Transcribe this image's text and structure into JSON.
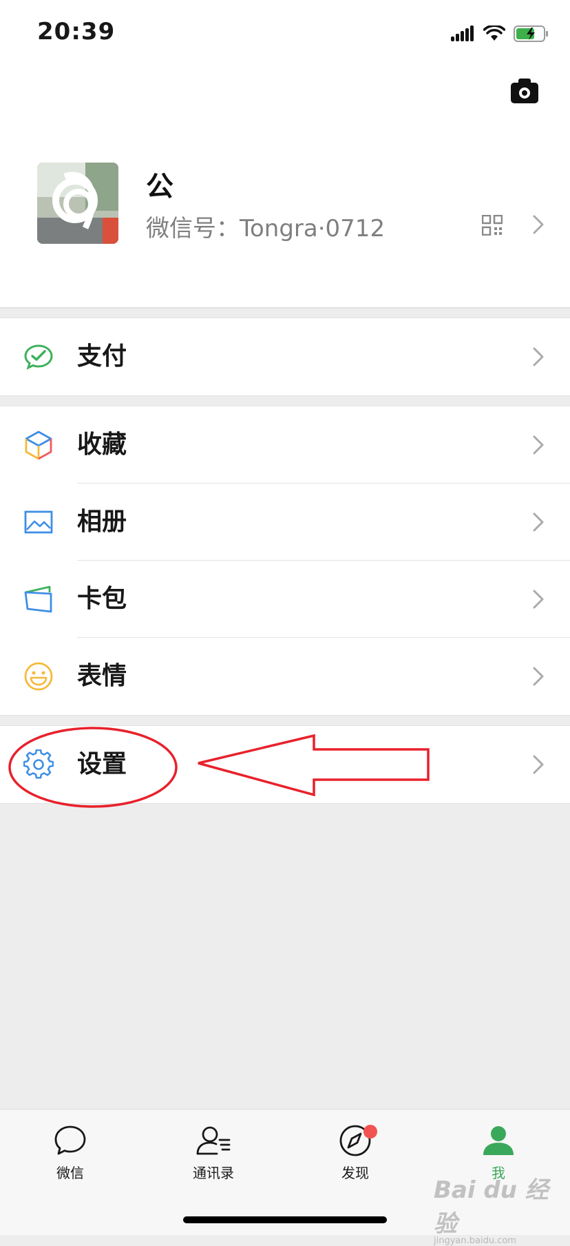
{
  "status_bar": {
    "time": "20:39"
  },
  "profile": {
    "nickname": "公",
    "wechat_id": "微信号：Tongra·0712"
  },
  "menu_groups": [
    {
      "items": [
        {
          "label": "支付",
          "icon": "pay-icon"
        }
      ]
    },
    {
      "items": [
        {
          "label": "收藏",
          "icon": "favorites-icon"
        },
        {
          "label": "相册",
          "icon": "album-icon"
        },
        {
          "label": "卡包",
          "icon": "cards-icon"
        },
        {
          "label": "表情",
          "icon": "sticker-icon"
        }
      ]
    },
    {
      "items": [
        {
          "label": "设置",
          "icon": "settings-icon"
        }
      ]
    }
  ],
  "tabbar": {
    "tabs": [
      {
        "label": "微信",
        "icon": "chat-icon"
      },
      {
        "label": "通讯录",
        "icon": "contacts-icon"
      },
      {
        "label": "发现",
        "icon": "discover-icon",
        "badge": true
      },
      {
        "label": "我",
        "icon": "me-icon",
        "active": true
      }
    ]
  },
  "watermark": {
    "text": "Bai du 经验",
    "sub": "jingyan.baidu.com"
  },
  "colors": {
    "accent": "#3aa85a",
    "badge": "#f25350",
    "annotation": "#e8212b"
  }
}
